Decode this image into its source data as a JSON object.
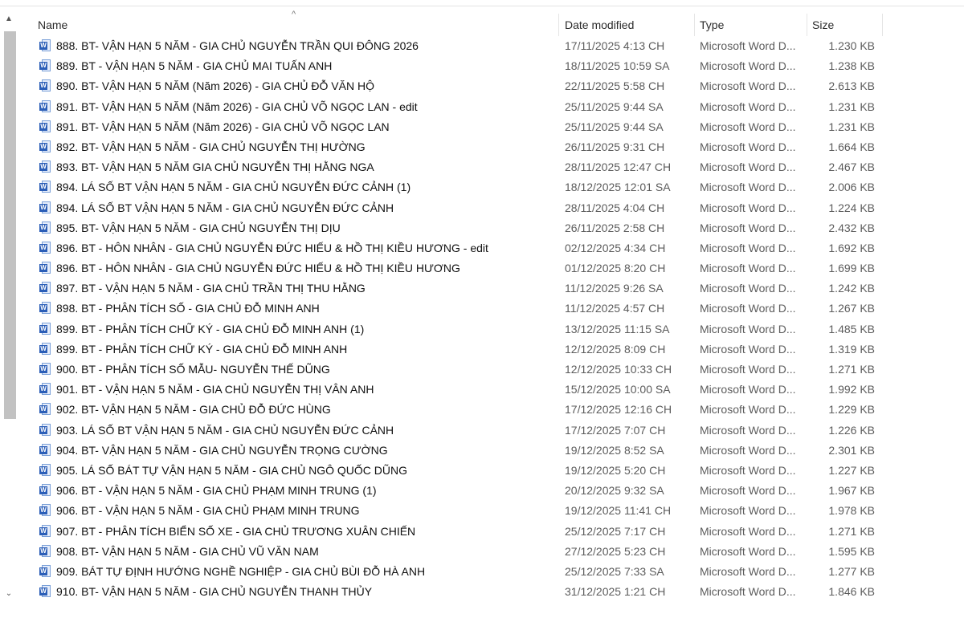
{
  "columns": {
    "name": "Name",
    "date": "Date modified",
    "type": "Type",
    "size": "Size"
  },
  "icon": "word-document-icon",
  "accent_color": "#2b5eb7",
  "files": [
    {
      "name": "888. BT- VẬN HẠN 5 NĂM - GIA CHỦ NGUYỄN TRẦN QUI ĐÔNG 2026",
      "date": "17/11/2025 4:13 CH",
      "type": "Microsoft Word D...",
      "size": "1.230 KB"
    },
    {
      "name": "889. BT - VẬN HẠN 5 NĂM - GIA CHỦ MAI TUẤN ANH",
      "date": "18/11/2025 10:59 SA",
      "type": "Microsoft Word D...",
      "size": "1.238 KB"
    },
    {
      "name": "890. BT- VẬN HẠN 5 NĂM (Năm 2026) - GIA CHỦ ĐỖ VĂN HỘ",
      "date": "22/11/2025 5:58 CH",
      "type": "Microsoft Word D...",
      "size": "2.613 KB"
    },
    {
      "name": "891. BT- VẬN HẠN 5 NĂM (Năm 2026) - GIA CHỦ VÕ NGỌC LAN - edit",
      "date": "25/11/2025 9:44 SA",
      "type": "Microsoft Word D...",
      "size": "1.231 KB"
    },
    {
      "name": "891. BT- VẬN HẠN 5 NĂM (Năm 2026) - GIA CHỦ VÕ NGỌC LAN",
      "date": "25/11/2025 9:44 SA",
      "type": "Microsoft Word D...",
      "size": "1.231 KB"
    },
    {
      "name": "892. BT- VẬN HẠN 5 NĂM - GIA CHỦ NGUYỄN THỊ HƯỜNG",
      "date": "26/11/2025 9:31 CH",
      "type": "Microsoft Word D...",
      "size": "1.664 KB"
    },
    {
      "name": "893. BT- VẬN HẠN 5 NĂM GIA CHỦ NGUYỄN THỊ HẰNG NGA",
      "date": "28/11/2025 12:47 CH",
      "type": "Microsoft Word D...",
      "size": "2.467 KB"
    },
    {
      "name": "894. LÁ SỐ BT VẬN HẠN 5 NĂM - GIA CHỦ NGUYỄN ĐỨC CẢNH (1)",
      "date": "18/12/2025 12:01 SA",
      "type": "Microsoft Word D...",
      "size": "2.006 KB"
    },
    {
      "name": "894. LÁ SỐ BT VẬN HẠN 5 NĂM - GIA CHỦ NGUYỄN ĐỨC CẢNH",
      "date": "28/11/2025 4:04 CH",
      "type": "Microsoft Word D...",
      "size": "1.224 KB"
    },
    {
      "name": "895. BT- VẬN HẠN 5 NĂM - GIA CHỦ NGUYỄN THỊ DỊU",
      "date": "26/11/2025 2:58 CH",
      "type": "Microsoft Word D...",
      "size": "2.432 KB"
    },
    {
      "name": "896. BT - HÔN NHÂN - GIA CHỦ NGUYỄN ĐỨC HIẾU & HỒ THỊ KIỀU HƯƠNG - edit",
      "date": "02/12/2025 4:34 CH",
      "type": "Microsoft Word D...",
      "size": "1.692 KB"
    },
    {
      "name": "896. BT - HÔN NHÂN - GIA CHỦ NGUYỄN ĐỨC HIẾU & HỒ THỊ KIỀU HƯƠNG",
      "date": "01/12/2025 8:20 CH",
      "type": "Microsoft Word D...",
      "size": "1.699 KB"
    },
    {
      "name": "897. BT - VẬN HẠN 5 NĂM - GIA CHỦ TRẦN THỊ THU HẰNG",
      "date": "11/12/2025 9:26 SA",
      "type": "Microsoft Word D...",
      "size": "1.242 KB"
    },
    {
      "name": "898. BT - PHÂN TÍCH SỐ - GIA CHỦ ĐỖ MINH ANH",
      "date": "11/12/2025 4:57 CH",
      "type": "Microsoft Word D...",
      "size": "1.267 KB"
    },
    {
      "name": "899. BT - PHÂN TÍCH CHỮ KÝ - GIA CHỦ ĐỖ MINH ANH (1)",
      "date": "13/12/2025 11:15 SA",
      "type": "Microsoft Word D...",
      "size": "1.485 KB"
    },
    {
      "name": "899. BT - PHÂN TÍCH CHỮ KÝ - GIA CHỦ ĐỖ MINH ANH",
      "date": "12/12/2025 8:09 CH",
      "type": "Microsoft Word D...",
      "size": "1.319 KB"
    },
    {
      "name": "900. BT - PHÂN TÍCH SỐ MẪU- NGUYỄN THẾ DŨNG",
      "date": "12/12/2025 10:33 CH",
      "type": "Microsoft Word D...",
      "size": "1.271 KB"
    },
    {
      "name": "901. BT - VẬN HẠN 5 NĂM - GIA CHỦ NGUYỄN THỊ VÂN ANH",
      "date": "15/12/2025 10:00 SA",
      "type": "Microsoft Word D...",
      "size": "1.992 KB"
    },
    {
      "name": "902. BT- VẬN HẠN 5 NĂM - GIA CHỦ ĐỖ ĐỨC HÙNG",
      "date": "17/12/2025 12:16 CH",
      "type": "Microsoft Word D...",
      "size": "1.229 KB"
    },
    {
      "name": "903. LÁ SỐ BT VẬN HẠN 5 NĂM - GIA CHỦ NGUYỄN ĐỨC CẢNH",
      "date": "17/12/2025 7:07 CH",
      "type": "Microsoft Word D...",
      "size": "1.226 KB"
    },
    {
      "name": "904. BT- VẬN HẠN 5 NĂM - GIA CHỦ NGUYỄN TRỌNG CƯỜNG",
      "date": "19/12/2025 8:52 SA",
      "type": "Microsoft Word D...",
      "size": "2.301 KB"
    },
    {
      "name": "905. LÁ SỐ BÁT TỰ VẬN HẠN 5 NĂM - GIA CHỦ NGÔ QUỐC DŨNG",
      "date": "19/12/2025 5:20 CH",
      "type": "Microsoft Word D...",
      "size": "1.227 KB"
    },
    {
      "name": "906. BT - VẬN HẠN 5 NĂM - GIA CHỦ PHẠM MINH TRUNG (1)",
      "date": "20/12/2025 9:32 SA",
      "type": "Microsoft Word D...",
      "size": "1.967 KB"
    },
    {
      "name": "906. BT - VẬN HẠN 5 NĂM - GIA CHỦ PHẠM MINH TRUNG",
      "date": "19/12/2025 11:41 CH",
      "type": "Microsoft Word D...",
      "size": "1.978 KB"
    },
    {
      "name": "907. BT - PHÂN TÍCH BIỂN SỐ XE - GIA CHỦ TRƯƠNG XUÂN CHIẾN",
      "date": "25/12/2025 7:17 CH",
      "type": "Microsoft Word D...",
      "size": "1.271 KB"
    },
    {
      "name": "908. BT- VẬN HẠN 5 NĂM  - GIA CHỦ VŨ VĂN NAM",
      "date": "27/12/2025 5:23 CH",
      "type": "Microsoft Word D...",
      "size": "1.595 KB"
    },
    {
      "name": "909. BÁT TỰ ĐỊNH HƯỚNG NGHỀ NGHIỆP - GIA CHỦ BÙI ĐỖ HÀ ANH",
      "date": "25/12/2025 7:33 SA",
      "type": "Microsoft Word D...",
      "size": "1.277 KB"
    },
    {
      "name": "910. BT- VẬN HẠN 5 NĂM - GIA CHỦ NGUYỄN THANH THỦY",
      "date": "31/12/2025 1:21 CH",
      "type": "Microsoft Word D...",
      "size": "1.846 KB"
    }
  ]
}
